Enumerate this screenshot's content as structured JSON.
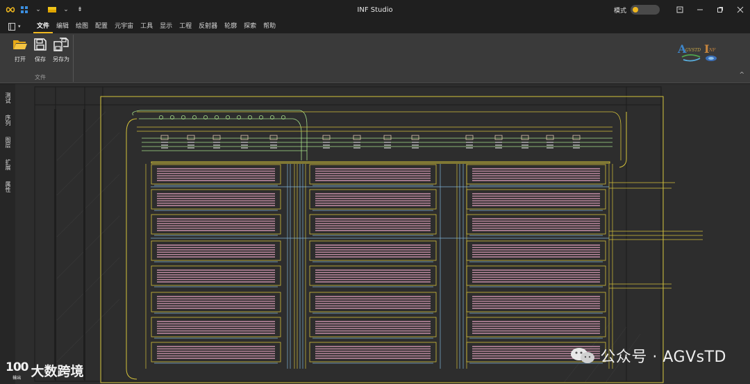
{
  "app": {
    "title": "INF Studio",
    "mode_label": "模式",
    "mode_on": true
  },
  "quick_access": {
    "icons": [
      "infinity-icon",
      "layout-grid-icon",
      "chevron-down-icon",
      "folder-color-icon",
      "chevron-down-icon",
      "customize-icon"
    ]
  },
  "window_controls": [
    "restore-panel-icon",
    "minimize-icon",
    "maximize-icon",
    "close-icon"
  ],
  "menu": {
    "items": [
      "文件",
      "编辑",
      "绘图",
      "配置",
      "元宇宙",
      "工具",
      "显示",
      "工程",
      "反射器",
      "轮廓",
      "探索",
      "帮助"
    ],
    "active_index": 0
  },
  "ribbon": {
    "group_label": "文件",
    "buttons": [
      {
        "label": "打开",
        "icon": "folder-open-icon"
      },
      {
        "label": "保存",
        "icon": "save-icon"
      },
      {
        "label": "另存为",
        "icon": "save-as-icon"
      }
    ],
    "logo_text": "AgvstdInf"
  },
  "sidebar": {
    "tabs": [
      "测试",
      "序列",
      "图层",
      "扩展",
      "属性"
    ]
  },
  "watermarks": {
    "right_text": "公众号 · AGVsTD",
    "left_logo": "100",
    "left_sub": "输出",
    "left_brand": "大数跨境"
  },
  "colors": {
    "accent": "#f0b81f",
    "background": "#2d2d2d",
    "track_yellow": "#d4c23a",
    "track_green": "#a7e08a",
    "rack_pink": "#c78fa8",
    "track_blue": "#7fb3d9"
  }
}
